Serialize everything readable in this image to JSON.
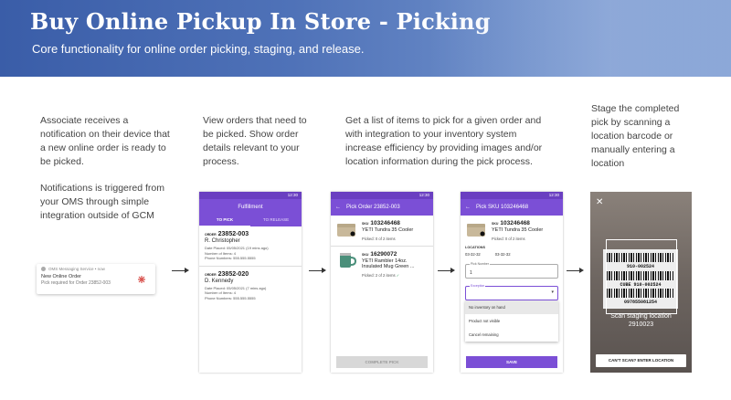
{
  "header": {
    "title": "Buy Online Pickup In Store - Picking",
    "subtitle": "Core functionality for online order picking, staging, and release."
  },
  "steps": [
    {
      "p1": "Associate receives a notification on their device that a new online order is ready to be picked.",
      "p2": "Notifications is triggered from your OMS through simple integration outside of GCM"
    },
    {
      "p1": "View orders that need to be picked.  Show order details relevant to your process."
    },
    {
      "p1": "Get a list of items to pick for a given order and with integration to your inventory system increase efficiency by providing images and/or location information  during the pick process."
    },
    {
      "p1": "Stage the completed pick by scanning a location barcode or manually entering a location"
    }
  ],
  "notification": {
    "source": "OMS Messaging Service • now",
    "title": "New Online Order",
    "body": "Pick required for Order 23852-003"
  },
  "screen1": {
    "time": "12:30",
    "title": "Fulfillment",
    "tabs": [
      "TO PICK",
      "TO RELEASE"
    ],
    "orders": [
      {
        "prefix": "ORDER",
        "number": "23852-003",
        "name": "R. Christopher",
        "placed": "Date Placed: 05/05/2021 (19 mins ago)",
        "items": "Number of Items: 4",
        "phone": "Phone Numbers: 555.555.5555"
      },
      {
        "prefix": "ORDER",
        "number": "23852-020",
        "name": "D. Kennedy",
        "placed": "Date Placed: 05/05/2021 (7 mins ago)",
        "items": "Number of Items: 4",
        "phone": "Phone Numbers: 555.555.5555"
      }
    ]
  },
  "screen2": {
    "time": "12:30",
    "title": "Pick Order 23852-003",
    "items": [
      {
        "prefix": "SKU",
        "sku": "103246468",
        "name": "YETI Tundra 35 Cooler",
        "picked": "Picked: 0 of 2 items"
      },
      {
        "prefix": "SKU",
        "sku": "16290072",
        "name": "YETI Rambler 14oz. Insulated Mug Green ...",
        "picked": "Picked: 2 of 2 items"
      }
    ],
    "button": "COMPLETE PICK"
  },
  "screen3": {
    "time": "12:30",
    "title": "Pick SKU 103246468",
    "item": {
      "prefix": "SKU",
      "sku": "103246468",
      "name": "YETI Tundra 35 Cooler",
      "picked": "Picked: 0 of 2 items"
    },
    "locations_label": "LOCATIONS",
    "locations": [
      "03-32-32",
      "03-32-32"
    ],
    "pick_number_label": "Pick Number",
    "pick_number_value": "1",
    "exception_label": "Exception",
    "options": [
      "No inventory on hand",
      "Product not visible",
      "Cancel remaining"
    ],
    "button": "SAVE"
  },
  "screen4": {
    "barcode1": "910-002524",
    "cube": "CUBE 910-002524",
    "barcode2": "097855081254",
    "message_line1": "Scan staging location",
    "message_line2": "2910023",
    "button": "CAN'T SCAN? ENTER LOCATION"
  },
  "colors": {
    "primary": "#7b4fd6",
    "banner": "#4f72b8"
  }
}
